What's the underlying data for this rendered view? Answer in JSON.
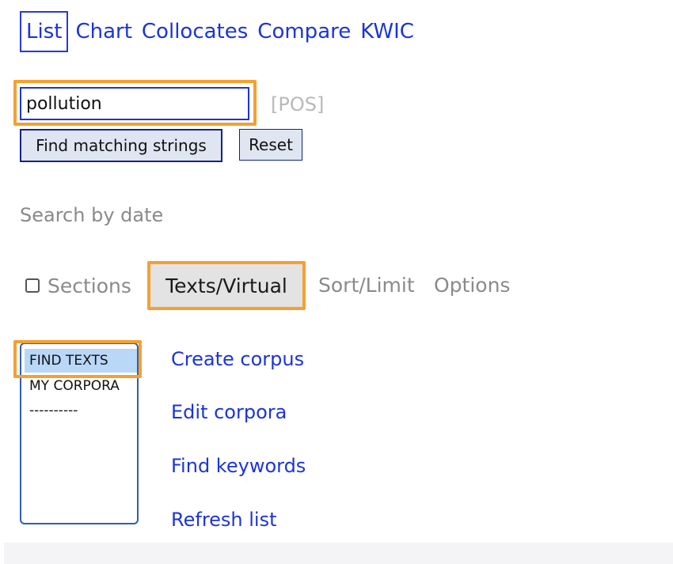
{
  "nav": {
    "items": [
      {
        "label": "List",
        "active": true
      },
      {
        "label": "Chart",
        "active": false
      },
      {
        "label": "Collocates",
        "active": false
      },
      {
        "label": "Compare",
        "active": false
      },
      {
        "label": "KWIC",
        "active": false
      }
    ]
  },
  "search": {
    "value": "pollution",
    "pos_label": "[POS]"
  },
  "buttons": {
    "find_label": "Find matching strings",
    "reset_label": "Reset"
  },
  "search_by_date_label": "Search by date",
  "tabs": {
    "sections_label": "Sections",
    "sections_checked": false,
    "texts_label": "Texts/Virtual",
    "sort_label": "Sort/Limit",
    "options_label": "Options"
  },
  "corpus_list": {
    "options": [
      "FIND TEXTS",
      "MY CORPORA",
      "----------"
    ],
    "selected_index": 0
  },
  "actions": {
    "create_corpus": "Create corpus",
    "edit_corpora": "Edit corpora",
    "find_keywords": "Find keywords",
    "refresh_list": "Refresh list"
  },
  "colors": {
    "link": "#1c34d8",
    "highlight": "#f5a030",
    "button_bg": "#dfe6f1",
    "selected_option": "#b9d7f7"
  }
}
